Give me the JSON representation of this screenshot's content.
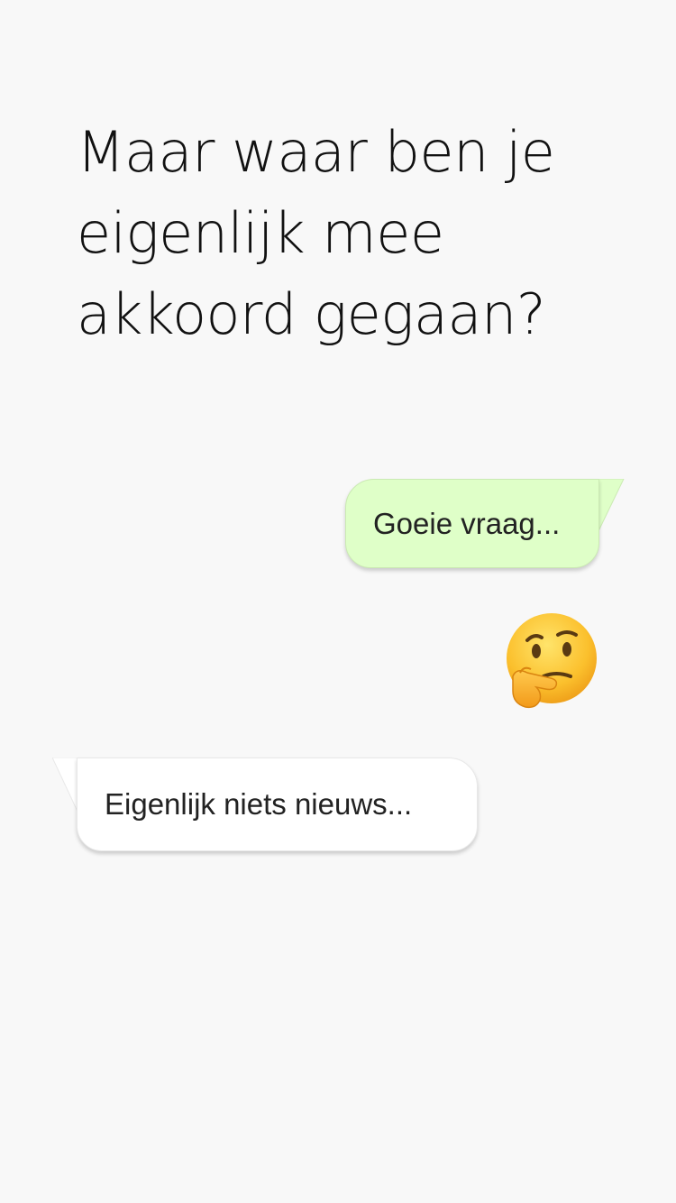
{
  "heading": "Maar waar ben je eigenlijk mee akkoord gegaan?",
  "messages": {
    "outgoing": {
      "text": "Goeie vraag...",
      "color": "#dfffc8"
    },
    "emoji": {
      "icon": "thinking-face-icon"
    },
    "incoming": {
      "text": "Eigenlijk niets nieuws...",
      "color": "#ffffff"
    }
  },
  "colors": {
    "background": "#f8f8f8",
    "text": "#111111"
  }
}
